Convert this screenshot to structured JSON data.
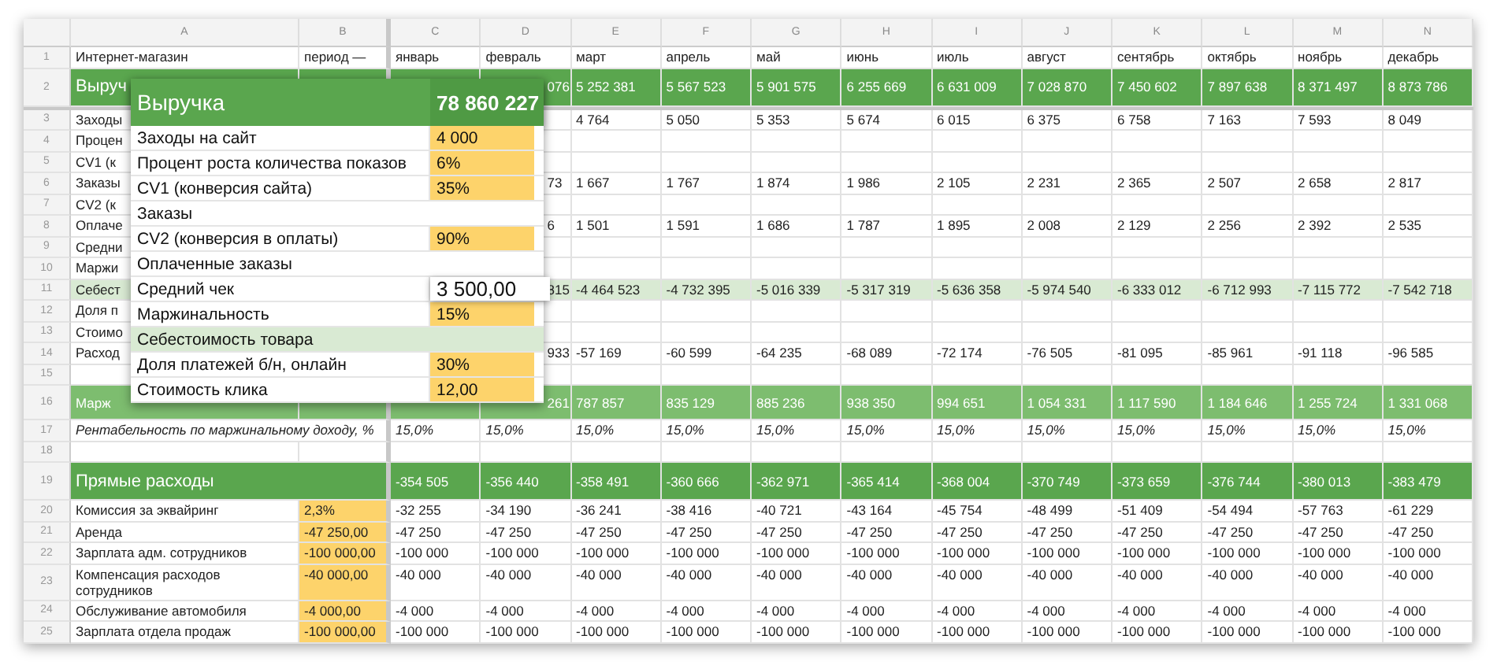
{
  "columns": [
    "A",
    "B",
    "C",
    "D",
    "E",
    "F",
    "G",
    "H",
    "I",
    "J",
    "K",
    "L",
    "M",
    "N"
  ],
  "rows": [
    {
      "number": "1",
      "kind": "plain",
      "cells": [
        "Интернет-магазин",
        "период —",
        "январь",
        "февраль",
        "март",
        "апрель",
        "май",
        "июнь",
        "июль",
        "август",
        "сентябрь",
        "октябрь",
        "ноябрь",
        "декабрь"
      ]
    },
    {
      "number": "2",
      "kind": "green",
      "cells": [
        "Выруч",
        null,
        null,
        "076",
        "5 252 381",
        "5 567 523",
        "5 901 575",
        "6 255 669",
        "6 631 009",
        "7 028 870",
        "7 450 602",
        "7 897 638",
        "8 371 497",
        "8 873 786"
      ]
    },
    {
      "number": "3",
      "kind": "plain",
      "cells": [
        "Заходы",
        null,
        null,
        null,
        "4 764",
        "5 050",
        "5 353",
        "5 674",
        "6 015",
        "6 375",
        "6 758",
        "7 163",
        "7 593",
        "8 049"
      ]
    },
    {
      "number": "4",
      "kind": "plain",
      "cells": [
        "Процен",
        null,
        null,
        null,
        null,
        null,
        null,
        null,
        null,
        null,
        null,
        null,
        null,
        null
      ]
    },
    {
      "number": "5",
      "kind": "plain",
      "cells": [
        "CV1 (к",
        null,
        null,
        null,
        null,
        null,
        null,
        null,
        null,
        null,
        null,
        null,
        null,
        null
      ]
    },
    {
      "number": "6",
      "kind": "plain",
      "cells": [
        "Заказы",
        null,
        null,
        "73",
        "1 667",
        "1 767",
        "1 874",
        "1 986",
        "2 105",
        "2 231",
        "2 365",
        "2 507",
        "2 658",
        "2 817"
      ]
    },
    {
      "number": "7",
      "kind": "plain",
      "cells": [
        "CV2 (к",
        null,
        null,
        null,
        null,
        null,
        null,
        null,
        null,
        null,
        null,
        null,
        null,
        null
      ]
    },
    {
      "number": "8",
      "kind": "plain",
      "cells": [
        "Оплаче",
        null,
        null,
        "6",
        "1 501",
        "1 591",
        "1 686",
        "1 787",
        "1 895",
        "2 008",
        "2 129",
        "2 256",
        "2 392",
        "2 535"
      ]
    },
    {
      "number": "9",
      "kind": "plain",
      "cells": [
        "Средни",
        null,
        null,
        null,
        null,
        null,
        null,
        null,
        null,
        null,
        null,
        null,
        null,
        null
      ]
    },
    {
      "number": "10",
      "kind": "plain",
      "cells": [
        "Маржи",
        null,
        null,
        null,
        null,
        null,
        null,
        null,
        null,
        null,
        null,
        null,
        null,
        null
      ]
    },
    {
      "number": "11",
      "kind": "light",
      "cells": [
        "Себест",
        null,
        null,
        "815",
        "-4 464 523",
        "-4 732 395",
        "-5 016 339",
        "-5 317 319",
        "-5 636 358",
        "-5 974 540",
        "-6 333 012",
        "-6 712 993",
        "-7 115 772",
        "-7 542 718"
      ]
    },
    {
      "number": "12",
      "kind": "plain",
      "cells": [
        "Доля п",
        null,
        null,
        null,
        null,
        null,
        null,
        null,
        null,
        null,
        null,
        null,
        null,
        null
      ]
    },
    {
      "number": "13",
      "kind": "plain",
      "cells": [
        "Стоимо",
        null,
        null,
        null,
        null,
        null,
        null,
        null,
        null,
        null,
        null,
        null,
        null,
        null
      ]
    },
    {
      "number": "14",
      "kind": "plain",
      "cells": [
        "Расход",
        null,
        null,
        "933",
        "-57 169",
        "-60 599",
        "-64 235",
        "-68 089",
        "-72 174",
        "-76 505",
        "-81 095",
        "-85 961",
        "-91 118",
        "-96 585"
      ]
    },
    {
      "number": "15",
      "kind": "plain",
      "cells": [
        null,
        null,
        null,
        null,
        null,
        null,
        null,
        null,
        null,
        null,
        null,
        null,
        null,
        null
      ]
    },
    {
      "number": "16",
      "kind": "medium",
      "cells": [
        "Марж",
        null,
        null,
        "261",
        "787 857",
        "835 129",
        "885 236",
        "938 350",
        "994 651",
        "1 054 331",
        "1 117 590",
        "1 184 646",
        "1 255 724",
        "1 331 068"
      ]
    },
    {
      "number": "17",
      "kind": "italic",
      "cells": [
        "Рентабельность по маржинальному доходу, %",
        null,
        "15,0%",
        "15,0%",
        "15,0%",
        "15,0%",
        "15,0%",
        "15,0%",
        "15,0%",
        "15,0%",
        "15,0%",
        "15,0%",
        "15,0%",
        "15,0%"
      ]
    },
    {
      "number": "18",
      "kind": "plain",
      "cells": [
        null,
        null,
        null,
        null,
        null,
        null,
        null,
        null,
        null,
        null,
        null,
        null,
        null,
        null
      ]
    },
    {
      "number": "19",
      "kind": "green",
      "cells": [
        "Прямые расходы",
        null,
        "-354 505",
        "-356 440",
        "-358 491",
        "-360 666",
        "-362 971",
        "-365 414",
        "-368 004",
        "-370 749",
        "-373 659",
        "-376 744",
        "-380 013",
        "-383 479"
      ]
    },
    {
      "number": "20",
      "kind": "input",
      "cells": [
        "Комиссия за эквайринг",
        "2,3%",
        "-32 255",
        "-34 190",
        "-36 241",
        "-38 416",
        "-40 721",
        "-43 164",
        "-45 754",
        "-48 499",
        "-51 409",
        "-54 494",
        "-57 763",
        "-61 229"
      ]
    },
    {
      "number": "21",
      "kind": "input",
      "cells": [
        "Аренда",
        "-47 250,00",
        "-47 250",
        "-47 250",
        "-47 250",
        "-47 250",
        "-47 250",
        "-47 250",
        "-47 250",
        "-47 250",
        "-47 250",
        "-47 250",
        "-47 250",
        "-47 250"
      ]
    },
    {
      "number": "22",
      "kind": "input",
      "cells": [
        "Зарплата адм. сотрудников",
        "-100 000,00",
        "-100 000",
        "-100 000",
        "-100 000",
        "-100 000",
        "-100 000",
        "-100 000",
        "-100 000",
        "-100 000",
        "-100 000",
        "-100 000",
        "-100 000",
        "-100 000"
      ]
    },
    {
      "number": "23",
      "kind": "input",
      "cells": [
        "Компенсация расходов сотрудников",
        "-40 000,00",
        "-40 000",
        "-40 000",
        "-40 000",
        "-40 000",
        "-40 000",
        "-40 000",
        "-40 000",
        "-40 000",
        "-40 000",
        "-40 000",
        "-40 000",
        "-40 000"
      ]
    },
    {
      "number": "24",
      "kind": "input",
      "cells": [
        "Обслуживание автомобиля",
        "-4 000,00",
        "-4 000",
        "-4 000",
        "-4 000",
        "-4 000",
        "-4 000",
        "-4 000",
        "-4 000",
        "-4 000",
        "-4 000",
        "-4 000",
        "-4 000",
        "-4 000"
      ]
    },
    {
      "number": "25",
      "kind": "input",
      "cells": [
        "Зарплата отдела продаж",
        "-100 000,00",
        "-100 000",
        "-100 000",
        "-100 000",
        "-100 000",
        "-100 000",
        "-100 000",
        "-100 000",
        "-100 000",
        "-100 000",
        "-100 000",
        "-100 000",
        "-100 000"
      ]
    }
  ],
  "popup": {
    "title": "Выручка",
    "total": "78 860 227",
    "rows": [
      {
        "label": "Заходы на сайт",
        "value": "4 000",
        "kind": "input"
      },
      {
        "label": "Процент роста количества показов",
        "value": "6%",
        "kind": "input"
      },
      {
        "label": "CV1 (конверсия сайта)",
        "value": "35%",
        "kind": "input"
      },
      {
        "label": "Заказы",
        "kind": "plain"
      },
      {
        "label": "CV2 (конверсия в оплаты)",
        "value": "90%",
        "kind": "input"
      },
      {
        "label": "Оплаченные заказы",
        "kind": "plain"
      },
      {
        "label": "Средний чек",
        "value": "3 500,00",
        "kind": "highlight"
      },
      {
        "label": "Маржинальность",
        "value": "15%",
        "kind": "input"
      },
      {
        "label": "Себестоимость товара",
        "kind": "section"
      },
      {
        "label": "Доля платежей б/н, онлайн",
        "value": "30%",
        "kind": "input"
      },
      {
        "label": "Стоимость клика",
        "value": "12,00",
        "kind": "input"
      }
    ]
  }
}
